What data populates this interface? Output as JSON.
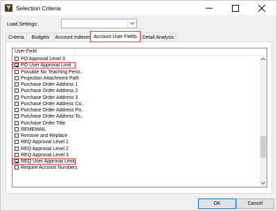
{
  "window": {
    "title": "Selection Criteria"
  },
  "load_settings": {
    "label": "Load Settings:",
    "value": ""
  },
  "tabs": [
    {
      "label": "Criteria",
      "active": false
    },
    {
      "label": "Budgets",
      "active": false
    },
    {
      "label": "Account Indexes",
      "active": false
    },
    {
      "label": "Account User Fields",
      "active": true
    },
    {
      "label": "Detail Analysis",
      "active": false
    }
  ],
  "list": {
    "column_header": "User Field",
    "items": [
      {
        "label": "PO Approval Level 3",
        "checked": false
      },
      {
        "label": "PO User Approval Limit",
        "checked": true
      },
      {
        "label": "Possible No Teaching Perio..",
        "checked": false
      },
      {
        "label": "Projection Attachment Path",
        "checked": false
      },
      {
        "label": "Purchase Order Address 1",
        "checked": false
      },
      {
        "label": "Purchase Order Address 2",
        "checked": false
      },
      {
        "label": "Purchase Order Address 3",
        "checked": false
      },
      {
        "label": "Purchase Order Address Co..",
        "checked": false
      },
      {
        "label": "Purchase Order Address Po..",
        "checked": false
      },
      {
        "label": "Purchase Order Address To..",
        "checked": false
      },
      {
        "label": "Purchase Order Title",
        "checked": false
      },
      {
        "label": "REMEMAIL",
        "checked": false
      },
      {
        "label": "Remove and Replace",
        "checked": false
      },
      {
        "label": "REQ Approval Level 1",
        "checked": false
      },
      {
        "label": "REQ Approval Level 2",
        "checked": false
      },
      {
        "label": "REQ Approval Level 3",
        "checked": false
      },
      {
        "label": "REQ User Approval Limit",
        "checked": true
      },
      {
        "label": "Require Account Numbers",
        "checked": false
      }
    ]
  },
  "buttons": {
    "ok": "OK",
    "cancel": "Cancel"
  },
  "colors": {
    "highlight": "#e03c3c",
    "default_button_border": "#0078d7"
  }
}
